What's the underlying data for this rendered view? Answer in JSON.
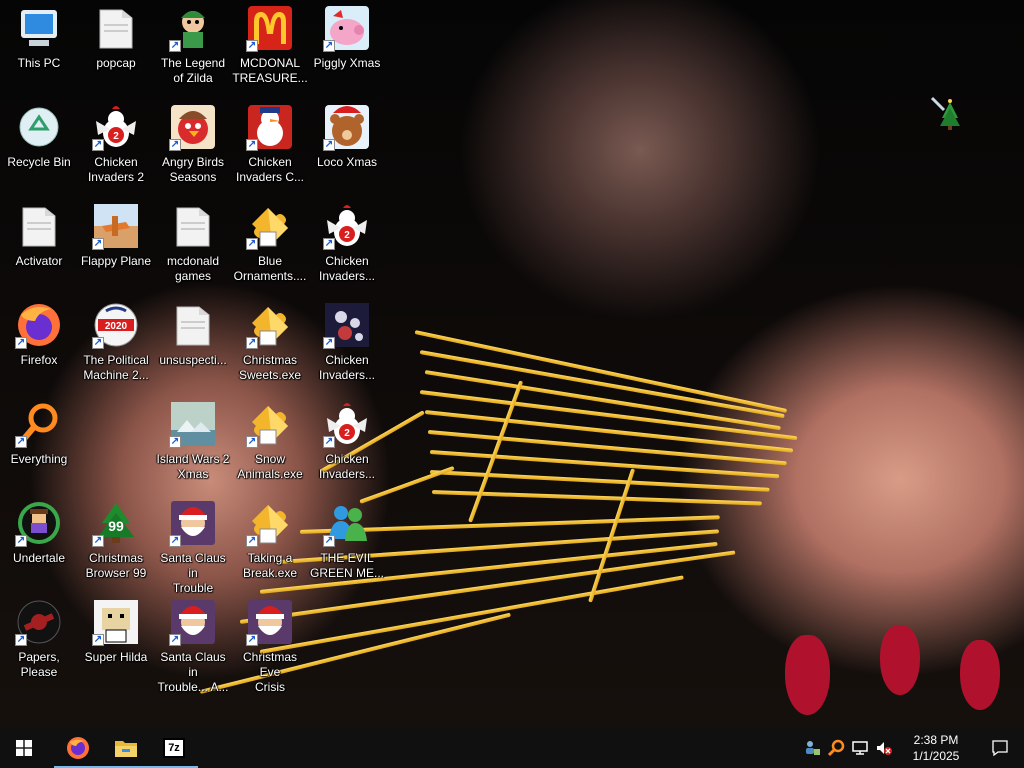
{
  "desktop": {
    "icons": [
      {
        "label": "This PC",
        "icon": "computer-icon",
        "col": 0,
        "row": 0,
        "shortcut": false
      },
      {
        "label": "popcap",
        "icon": "folder-icon",
        "col": 1,
        "row": 0,
        "shortcut": false
      },
      {
        "label": "The Legend\nof Zilda",
        "icon": "game-character-icon",
        "col": 2,
        "row": 0,
        "shortcut": true
      },
      {
        "label": "MCDONAL\nTREASURE...",
        "icon": "mcdonalds-icon",
        "col": 3,
        "row": 0,
        "shortcut": true
      },
      {
        "label": "Piggly Xmas",
        "icon": "pig-icon",
        "col": 4,
        "row": 0,
        "shortcut": true
      },
      {
        "label": "Recycle Bin",
        "icon": "recycle-bin-icon",
        "col": 0,
        "row": 1,
        "shortcut": false
      },
      {
        "label": "Chicken\nInvaders 2",
        "icon": "chicken-icon",
        "col": 1,
        "row": 1,
        "shortcut": true
      },
      {
        "label": "Angry Birds\nSeasons",
        "icon": "angry-bird-icon",
        "col": 2,
        "row": 1,
        "shortcut": true
      },
      {
        "label": "Chicken\nInvaders C...",
        "icon": "snowman-icon",
        "col": 3,
        "row": 1,
        "shortcut": true
      },
      {
        "label": "Loco Xmas",
        "icon": "bear-icon",
        "col": 4,
        "row": 1,
        "shortcut": true
      },
      {
        "label": "Activator",
        "icon": "folder-icon",
        "col": 0,
        "row": 2,
        "shortcut": false
      },
      {
        "label": "Flappy Plane",
        "icon": "plane-icon",
        "col": 1,
        "row": 2,
        "shortcut": true
      },
      {
        "label": "mcdonald\ngames",
        "icon": "folder-icon",
        "col": 2,
        "row": 2,
        "shortcut": false
      },
      {
        "label": "Blue\nOrnaments....",
        "icon": "puzzle-icon",
        "col": 3,
        "row": 2,
        "shortcut": true
      },
      {
        "label": "Chicken\nInvaders...",
        "icon": "chicken-icon",
        "col": 4,
        "row": 2,
        "shortcut": true
      },
      {
        "label": "Firefox",
        "icon": "firefox-icon",
        "col": 0,
        "row": 3,
        "shortcut": true
      },
      {
        "label": "The Political\nMachine 2...",
        "icon": "political-machine-icon",
        "col": 1,
        "row": 3,
        "shortcut": true
      },
      {
        "label": "unsuspecti...",
        "icon": "folder-icon",
        "col": 2,
        "row": 3,
        "shortcut": false
      },
      {
        "label": "Christmas\nSweets.exe",
        "icon": "puzzle-icon",
        "col": 3,
        "row": 3,
        "shortcut": true
      },
      {
        "label": "Chicken\nInvaders...",
        "icon": "spaceship-icon",
        "col": 4,
        "row": 3,
        "shortcut": true
      },
      {
        "label": "Everything",
        "icon": "search-ring-icon",
        "col": 0,
        "row": 4,
        "shortcut": true
      },
      {
        "label": "Island Wars 2\nXmas",
        "icon": "island-icon",
        "col": 2,
        "row": 4,
        "shortcut": true
      },
      {
        "label": "Snow\nAnimals.exe",
        "icon": "puzzle-icon",
        "col": 3,
        "row": 4,
        "shortcut": true
      },
      {
        "label": "Chicken\nInvaders...",
        "icon": "chicken-icon",
        "col": 4,
        "row": 4,
        "shortcut": true
      },
      {
        "label": "Undertale",
        "icon": "undertale-icon",
        "col": 0,
        "row": 5,
        "shortcut": true
      },
      {
        "label": "Christmas\nBrowser 99",
        "icon": "xmas-tree-icon",
        "col": 1,
        "row": 5,
        "shortcut": true
      },
      {
        "label": "Santa Claus in\nTrouble",
        "icon": "santa-icon",
        "col": 2,
        "row": 5,
        "shortcut": true
      },
      {
        "label": "Taking a\nBreak.exe",
        "icon": "puzzle-icon",
        "col": 3,
        "row": 5,
        "shortcut": true
      },
      {
        "label": "THE EVIL\nGREEN ME...",
        "icon": "messenger-icon",
        "col": 4,
        "row": 5,
        "shortcut": true
      },
      {
        "label": "Papers, Please",
        "icon": "papers-please-icon",
        "col": 0,
        "row": 6,
        "shortcut": true
      },
      {
        "label": "Super Hilda",
        "icon": "pixel-character-icon",
        "col": 1,
        "row": 6,
        "shortcut": true
      },
      {
        "label": "Santa Claus in\nTrouble... A...",
        "icon": "santa-icon",
        "col": 2,
        "row": 6,
        "shortcut": true
      },
      {
        "label": "Christmas Eve\nCrisis",
        "icon": "santa-icon",
        "col": 3,
        "row": 6,
        "shortcut": true
      }
    ]
  },
  "taskbar": {
    "start_label": "Start",
    "pinned": [
      {
        "name": "firefox-taskbar-button",
        "icon": "firefox-icon",
        "active": true
      },
      {
        "name": "file-explorer-taskbar-button",
        "icon": "folder-icon",
        "active": true
      },
      {
        "name": "7zip-taskbar-button",
        "icon": "7zip-icon",
        "active": true,
        "text": "7z"
      }
    ],
    "tray": {
      "icons": [
        "user-network-icon",
        "search-ring-icon",
        "network-icon",
        "volume-muted-icon"
      ],
      "time": "2:38 PM",
      "date": "1/1/2025"
    }
  },
  "colors": {
    "taskbar_bg": "#101010",
    "accent": "#76b9ed",
    "pasta": "#f0b830",
    "nail": "#b0122e"
  }
}
